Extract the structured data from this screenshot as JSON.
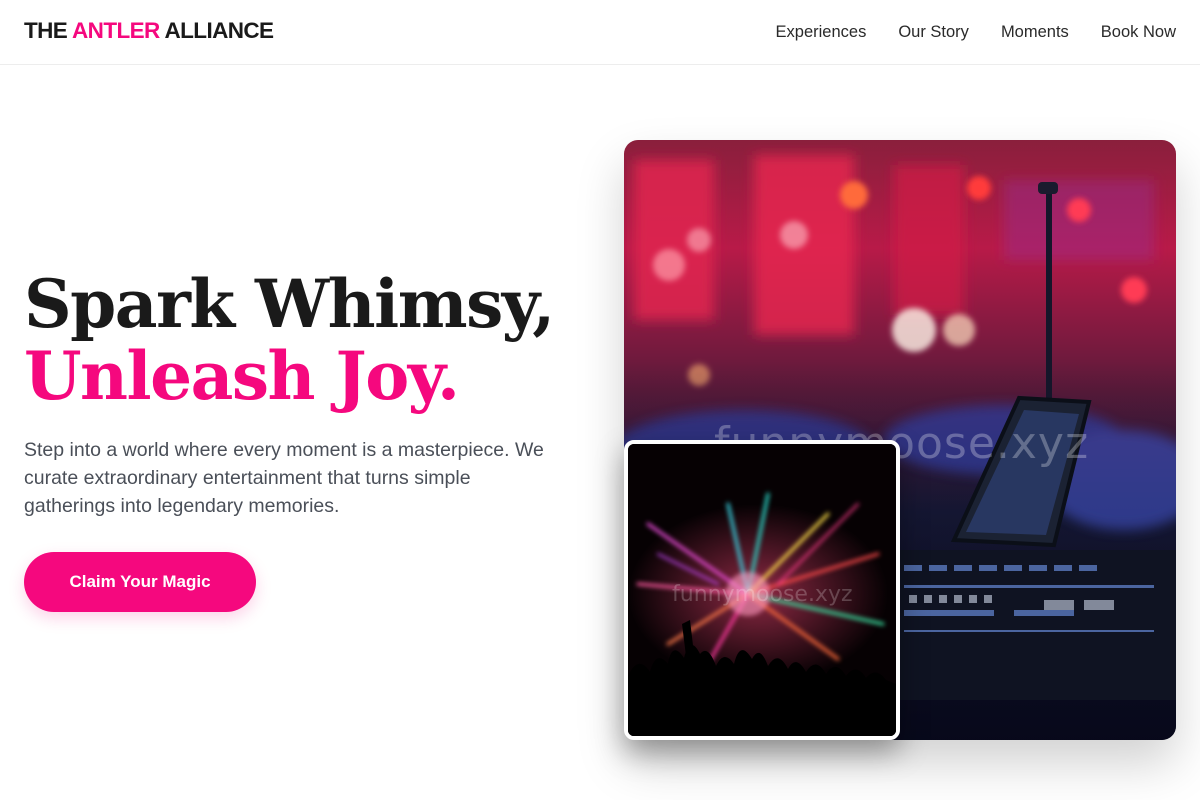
{
  "brand": {
    "logo_part1": "THE ",
    "logo_accent": "ANTLER",
    "logo_part2": " ALLIANCE",
    "accent_color": "#f5087e"
  },
  "nav": {
    "links": [
      "Experiences",
      "Our Story",
      "Moments",
      "Book Now"
    ]
  },
  "hero": {
    "title_line1": "Spark Whimsy,",
    "title_line2": "Unleash Joy.",
    "description": "Step into a world where every moment is a masterpiece. We curate extraordinary entertainment that turns simple gatherings into legendary memories.",
    "cta_label": "Claim Your Magic"
  },
  "images": {
    "main_alt": "Concert stage with lights and mixing console",
    "main_watermark": "funnymoose.xyz",
    "inset_alt": "Fireworks over a crowd",
    "inset_watermark": "funnymoose.xyz"
  }
}
